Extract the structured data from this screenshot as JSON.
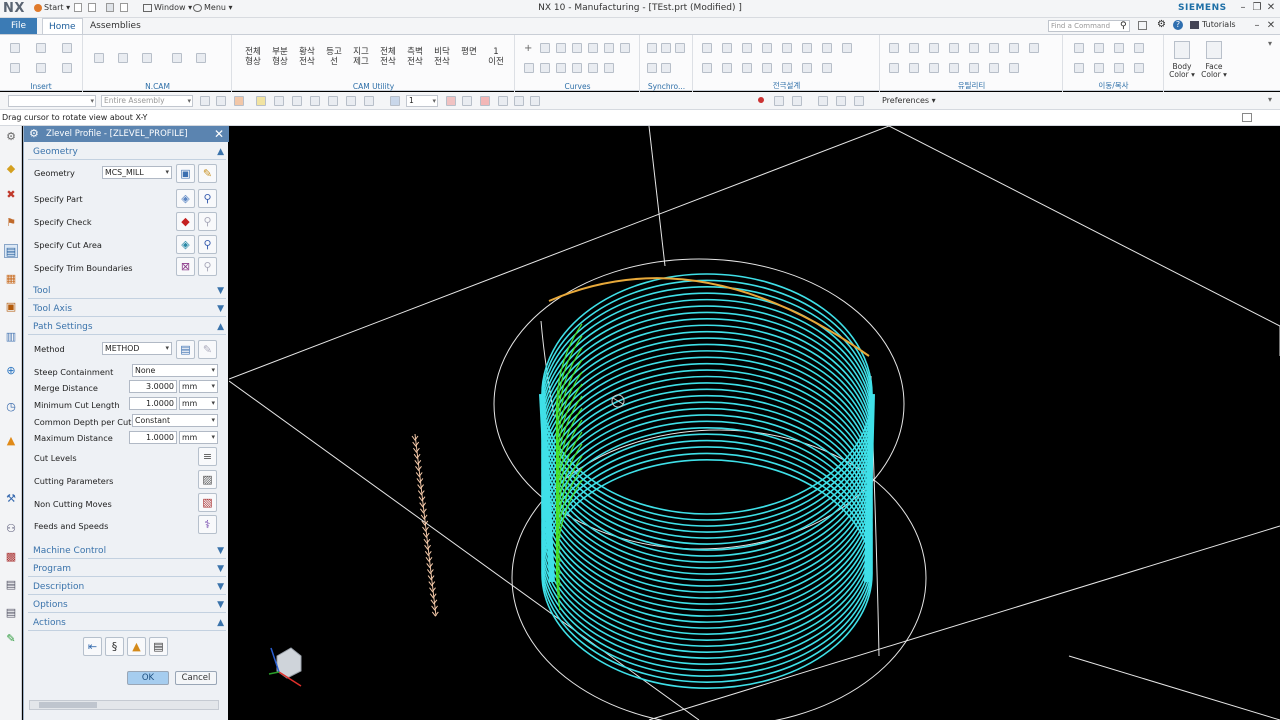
{
  "titlebar": {
    "logo": "NX",
    "start_label": "Start ▾",
    "window_label": "Window ▾",
    "menu_label": "Menu ▾",
    "title": "NX 10 - Manufacturing - [TEst.prt (Modified) ]",
    "brand": "SIEMENS"
  },
  "tabs": {
    "file": "File",
    "home": "Home",
    "assemblies": "Assemblies",
    "search_placeholder": "Find a Command",
    "tutorials": "Tutorials"
  },
  "ribbon": {
    "groups": {
      "insert": "Insert",
      "ncam": "N.CAM",
      "cam_utility": "CAM Utility",
      "curves": "Curves",
      "synchro": "Synchro...",
      "jeon_gu": "전극설계",
      "utility": "유틸리티",
      "move_copy": "이동/복사"
    },
    "korean_buttons": [
      {
        "l1": "전체",
        "l2": "형상"
      },
      {
        "l1": "부분",
        "l2": "형상"
      },
      {
        "l1": "황삭",
        "l2": "전삭"
      },
      {
        "l1": "등고",
        "l2": "선"
      },
      {
        "l1": "지그",
        "l2": "제그"
      },
      {
        "l1": "전체",
        "l2": "전삭"
      },
      {
        "l1": "측벽",
        "l2": "전삭"
      },
      {
        "l1": "비닥",
        "l2": "전삭"
      },
      {
        "l1": "평면",
        "l2": ""
      },
      {
        "l1": "1",
        "l2": "이전"
      }
    ],
    "body_color_1": "Body",
    "body_color_2": "Color ▾",
    "face_color_1": "Face",
    "face_color_2": "Color ▾"
  },
  "toolbar2": {
    "filter_placeholder": "",
    "assembly_scope": "Entire Assembly",
    "step_value": "1",
    "preferences": "Preferences ▾"
  },
  "cue": "Drag cursor to rotate view about X-Y",
  "dialog": {
    "title": "Zlevel Profile - [ZLEVEL_PROFILE]",
    "geometry_section": "Geometry",
    "geometry_label": "Geometry",
    "geometry_value": "MCS_MILL",
    "specify_part": "Specify Part",
    "specify_check": "Specify Check",
    "specify_cut_area": "Specify Cut Area",
    "specify_trim": "Specify Trim Boundaries",
    "tool_section": "Tool",
    "tool_axis_section": "Tool Axis",
    "path_settings_section": "Path Settings",
    "method_label": "Method",
    "method_value": "METHOD",
    "steep_label": "Steep Containment",
    "steep_value": "None",
    "merge_label": "Merge Distance",
    "merge_value": "3.0000",
    "merge_unit": "mm",
    "min_cut_label": "Minimum Cut Length",
    "min_cut_value": "1.0000",
    "min_cut_unit": "mm",
    "common_depth_label": "Common Depth per Cut",
    "common_depth_value": "Constant",
    "max_dist_label": "Maximum Distance",
    "max_dist_value": "1.0000",
    "max_dist_unit": "mm",
    "cut_levels": "Cut Levels",
    "cutting_params": "Cutting Parameters",
    "non_cutting": "Non Cutting Moves",
    "feeds_speeds": "Feeds and Speeds",
    "machine_control_section": "Machine Control",
    "program_section": "Program",
    "description_section": "Description",
    "options_section": "Options",
    "actions_section": "Actions",
    "ok": "OK",
    "cancel": "Cancel"
  },
  "colors": {
    "accent": "#3a73ab",
    "toolpath": "#3fe0e8",
    "toolpath_green": "#49e02a",
    "toolpath_orange": "#e8a93a",
    "outline": "#e6e6e6"
  }
}
